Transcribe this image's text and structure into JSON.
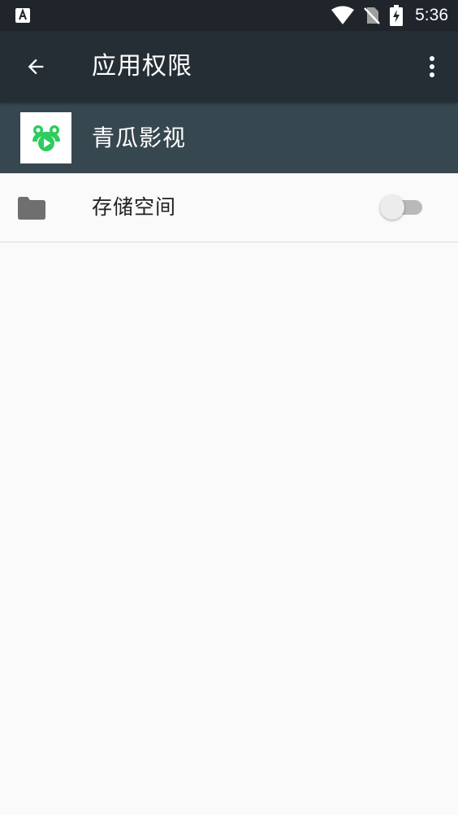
{
  "status_bar": {
    "time": "5:36",
    "icons": [
      "notification-a-icon",
      "wifi-icon",
      "no-sim-icon",
      "battery-charging-icon"
    ],
    "background": "#1f252b"
  },
  "app_bar": {
    "title": "应用权限",
    "back_icon": "arrow-back-icon",
    "menu_icon": "more-vert-icon",
    "background": "#262e35"
  },
  "app_header": {
    "app_name": "青瓜影视",
    "background": "#37474f",
    "icon_color": "#2ecc5e"
  },
  "permissions": [
    {
      "label": "存储空间",
      "icon": "folder-icon",
      "enabled": false
    }
  ]
}
